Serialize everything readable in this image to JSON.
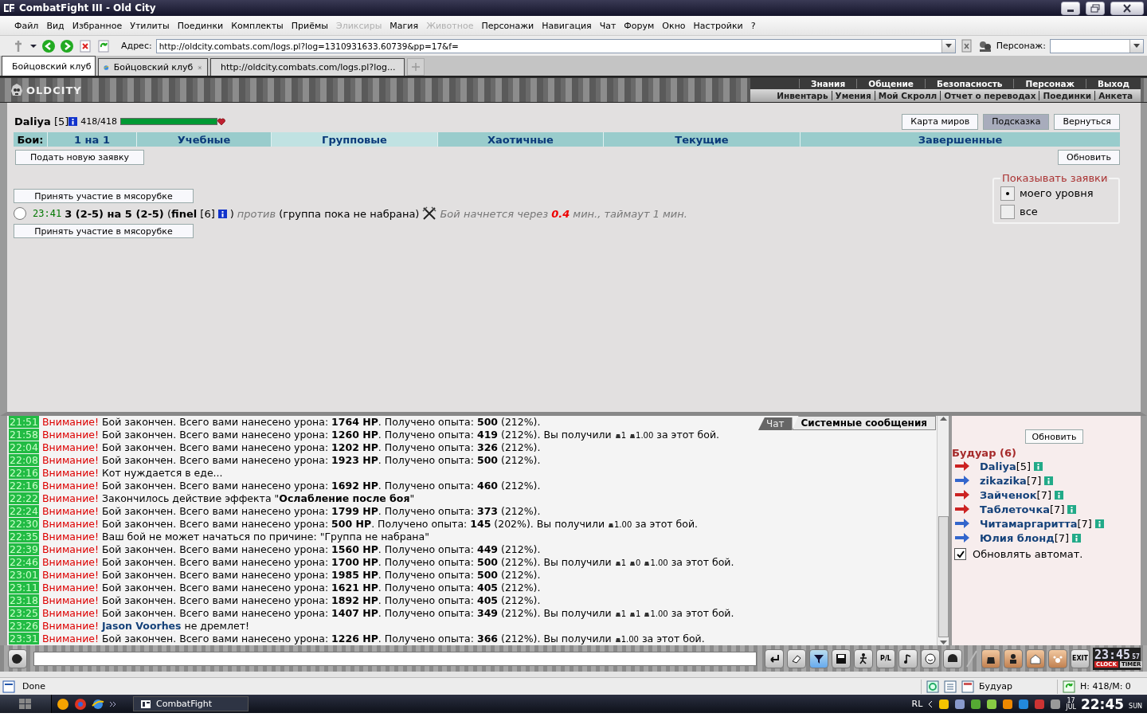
{
  "window": {
    "title": "CombatFight III - Old City"
  },
  "menu": [
    {
      "label": "Файл",
      "disabled": false
    },
    {
      "label": "Вид",
      "disabled": false
    },
    {
      "label": "Избранное",
      "disabled": false
    },
    {
      "label": "Утилиты",
      "disabled": false
    },
    {
      "label": "Поединки",
      "disabled": false
    },
    {
      "label": "Комплекты",
      "disabled": false
    },
    {
      "label": "Приёмы",
      "disabled": false
    },
    {
      "label": "Эликсиры",
      "disabled": true
    },
    {
      "label": "Магия",
      "disabled": false
    },
    {
      "label": "Животное",
      "disabled": true
    },
    {
      "label": "Персонажи",
      "disabled": false
    },
    {
      "label": "Навигация",
      "disabled": false
    },
    {
      "label": "Чат",
      "disabled": false
    },
    {
      "label": "Форум",
      "disabled": false
    },
    {
      "label": "Окно",
      "disabled": false
    },
    {
      "label": "Настройки",
      "disabled": false
    },
    {
      "label": "?",
      "disabled": false
    }
  ],
  "address": {
    "label": "Адрес:",
    "value": "http://oldcity.combats.com/logs.pl?log=1310931633.60739&pp=17&f="
  },
  "character": {
    "label": "Персонаж:"
  },
  "tabs": [
    {
      "label": "Бойцовский клуб",
      "selected": true
    },
    {
      "label": "Бойцовский клуб",
      "selected": false
    },
    {
      "label": "http://oldcity.combats.com/logs.pl?log...",
      "selected": false
    }
  ],
  "game_header": {
    "logo": "OLDCITY",
    "nav_top": [
      "Знания",
      "Общение",
      "Безопасность",
      "Персонаж",
      "Выход"
    ],
    "nav_bottom": [
      "Инвентарь",
      "Умения",
      "Мой Скролл",
      "Отчет о переводах",
      "Поединки",
      "Анкета"
    ]
  },
  "player": {
    "name": "Daliya",
    "rank": "[5]",
    "hp": "418/418",
    "hp_bar": {
      "level": 1
    }
  },
  "top_buttons": [
    {
      "label": "Карта миров",
      "selected": false
    },
    {
      "label": "Подсказка",
      "selected": true
    },
    {
      "label": "Вернуться",
      "selected": false
    }
  ],
  "fight_tabs": {
    "label": "Бои:",
    "items": [
      {
        "label": "1 на 1",
        "selected": false
      },
      {
        "label": "Учебные",
        "selected": false
      },
      {
        "label": "Групповые",
        "selected": true
      },
      {
        "label": "Хаотичные",
        "selected": false
      },
      {
        "label": "Текущие",
        "selected": false
      },
      {
        "label": "Завершенные",
        "selected": false
      }
    ]
  },
  "new_request_button": "Подать новую заявку",
  "refresh_button": "Обновить",
  "show_requests": {
    "legend": "Показывать заявки",
    "options": [
      {
        "label": "моего уровня",
        "selected": true
      },
      {
        "label": "все",
        "selected": false
      }
    ]
  },
  "request": {
    "join_button_above": "Принять участие в мясорубке",
    "selected": false,
    "time": "23:41",
    "teams": "**3 (2-5) на 5 (2-5)** (**finel** [6]",
    "close": ")",
    "against": "против",
    "group": "(группа пока не набрана)",
    "status": "Бой начнется через **0.4** мин., таймаут 1 мин.",
    "join_button_below": "Принять участие в мясорубке"
  },
  "chat_tabs": [
    {
      "label": "Чат",
      "selected": false
    },
    {
      "label": "Системные сообщения",
      "selected": true
    }
  ],
  "messages": [
    {
      "time": "21:51",
      "label": "Внимание!",
      "kind": "system",
      "text": "Бой закончен. Всего вами нанесено урона: **1764 HP**. Получено опыта: **500** (212%)."
    },
    {
      "time": "21:58",
      "label": "Внимание!",
      "kind": "system",
      "text": "Бой закончен. Всего вами нанесено урона: **1260 HP**. Получено опыта: **419** (212%). Вы получили",
      "rewards": [
        "1",
        "1.00"
      ],
      "tail": "за этот бой."
    },
    {
      "time": "22:04",
      "label": "Внимание!",
      "kind": "system",
      "text": "Бой закончен. Всего вами нанесено урона: **1202 HP**. Получено опыта: **326** (212%)."
    },
    {
      "time": "22:08",
      "label": "Внимание!",
      "kind": "system",
      "text": "Бой закончен. Всего вами нанесено урона: **1923 HP**. Получено опыта: **500** (212%)."
    },
    {
      "time": "22:16",
      "label": "Внимание!",
      "kind": "system",
      "text": "Кот нуждается в еде..."
    },
    {
      "time": "22:16",
      "label": "Внимание!",
      "kind": "system",
      "text": "Бой закончен. Всего вами нанесено урона: **1692 HP**. Получено опыта: **460** (212%)."
    },
    {
      "time": "22:22",
      "label": "Внимание!",
      "kind": "system",
      "text": "Закончилось действие эффекта \"**Ослабление после боя**\""
    },
    {
      "time": "22:24",
      "label": "Внимание!",
      "kind": "system",
      "text": "Бой закончен. Всего вами нанесено урона: **1799 HP**. Получено опыта: **373** (212%)."
    },
    {
      "time": "22:30",
      "label": "Внимание!",
      "kind": "system",
      "text": "Бой закончен. Всего вами нанесено урона: **500 HP**. Получено опыта: **145** (202%). Вы получили",
      "rewards": [
        "1.00"
      ],
      "tail": "за этот бой."
    },
    {
      "time": "22:35",
      "label": "Внимание!",
      "kind": "system",
      "text": "Ваш бой не может начаться по причине: \"Группа не набрана\""
    },
    {
      "time": "22:39",
      "label": "Внимание!",
      "kind": "system",
      "text": "Бой закончен. Всего вами нанесено урона: **1560 HP**. Получено опыта: **449** (212%)."
    },
    {
      "time": "22:46",
      "label": "Внимание!",
      "kind": "system",
      "text": "Бой закончен. Всего вами нанесено урона: **1700 HP**. Получено опыта: **500** (212%). Вы получили",
      "rewards": [
        "1",
        "0",
        "1.00"
      ],
      "tail": "за этот бой."
    },
    {
      "time": "23:01",
      "label": "Внимание!",
      "kind": "system",
      "text": "Бой закончен. Всего вами нанесено урона: **1985 HP**. Получено опыта: **500** (212%)."
    },
    {
      "time": "23:11",
      "label": "Внимание!",
      "kind": "system",
      "text": "Бой закончен. Всего вами нанесено урона: **1621 HP**. Получено опыта: **405** (212%)."
    },
    {
      "time": "23:18",
      "label": "Внимание!",
      "kind": "system",
      "text": "Бой закончен. Всего вами нанесено урона: **1892 HP**. Получено опыта: **405** (212%)."
    },
    {
      "time": "23:25",
      "label": "Внимание!",
      "kind": "system",
      "text": "Бой закончен. Всего вами нанесено урона: **1407 HP**. Получено опыта: **349** (212%). Вы получили",
      "rewards": [
        "1",
        "1",
        "1.00"
      ],
      "tail": "за этот бой."
    },
    {
      "time": "23:26",
      "label": "Внимание!",
      "kind": "player",
      "text": "**Jason Voorhes** не дремлет!"
    },
    {
      "time": "23:31",
      "label": "Внимание!",
      "kind": "system",
      "text": "Бой закончен. Всего вами нанесено урона: **1226 HP**. Получено опыта: **366** (212%). Вы получили",
      "rewards": [
        "1.00"
      ],
      "tail": "за этот бой."
    }
  ],
  "sidebar": {
    "refresh_button": "Обновить",
    "room": "Будуар (6)",
    "users": [
      {
        "name": "Daliya",
        "rank": "[5]",
        "color": "#cc2222"
      },
      {
        "name": "zikazika",
        "rank": "[7]",
        "color": "#3366cc"
      },
      {
        "name": "Зайченок",
        "rank": "[7]",
        "color": "#cc2222"
      },
      {
        "name": "Таблеточка",
        "rank": "[7]",
        "color": "#cc2222"
      },
      {
        "name": "Читамаргаритта",
        "rank": "[7]",
        "color": "#3366cc"
      },
      {
        "name": "Юлия блонд",
        "rank": "[7]",
        "color": "#3366cc"
      }
    ],
    "auto_refresh": {
      "label": "Обновлять автомат.",
      "checked": true
    }
  },
  "bottom_bar": {
    "tool_label": "P/L",
    "exit_label": "EXIT",
    "clock": {
      "time": "23:45",
      "seconds": "57",
      "clock_label": "CLOCK",
      "timer_label": "TIMER"
    }
  },
  "status_bar": {
    "text": "Done",
    "zone": "Будуар",
    "stats": "H: 418/M: 0"
  },
  "taskbar": {
    "app": "CombatFight",
    "language": "RL",
    "day": "17",
    "month": "JUL",
    "time": "22:45",
    "weekday": "SUN"
  }
}
